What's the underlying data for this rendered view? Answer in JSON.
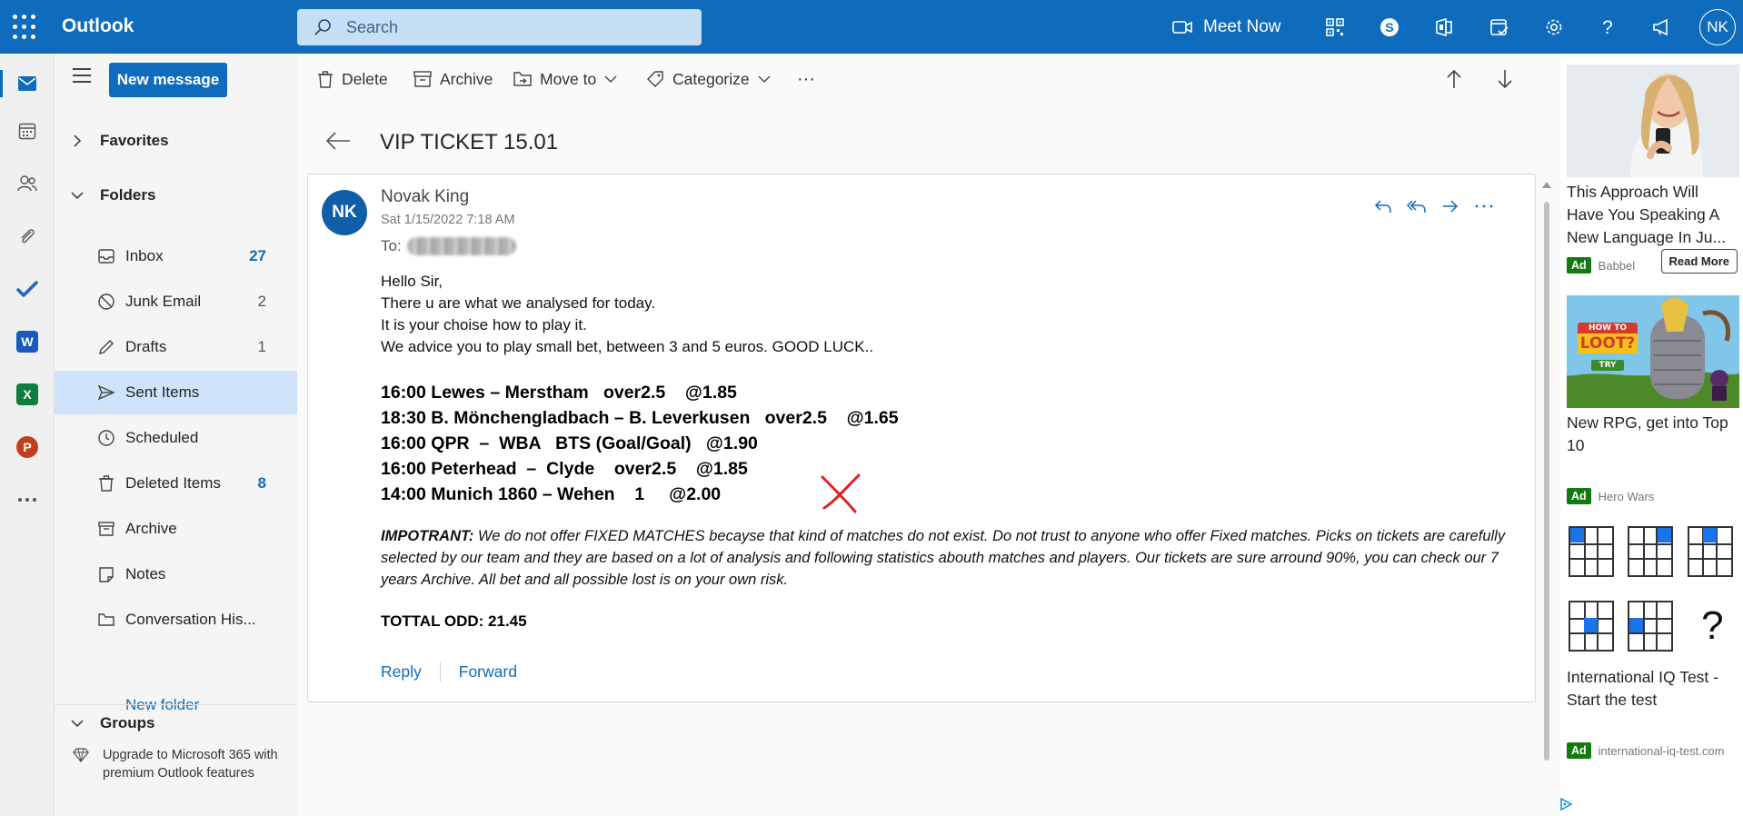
{
  "app": {
    "name": "Outlook",
    "avatar_initials": "NK"
  },
  "search": {
    "placeholder": "Search"
  },
  "topbar": {
    "meet_now": "Meet Now"
  },
  "folder_pane": {
    "new_message": "New message",
    "favorites": "Favorites",
    "folders": "Folders",
    "items": [
      {
        "label": "Inbox",
        "count": "27",
        "unread": true
      },
      {
        "label": "Junk Email",
        "count": "2",
        "unread": false
      },
      {
        "label": "Drafts",
        "count": "1",
        "unread": false
      },
      {
        "label": "Sent Items",
        "count": "",
        "unread": false,
        "selected": true
      },
      {
        "label": "Scheduled",
        "count": "",
        "unread": false
      },
      {
        "label": "Deleted Items",
        "count": "8",
        "unread": true
      },
      {
        "label": "Archive",
        "count": "",
        "unread": false
      },
      {
        "label": "Notes",
        "count": "",
        "unread": false
      },
      {
        "label": "Conversation His...",
        "count": "",
        "unread": false
      }
    ],
    "new_folder": "New folder",
    "groups": "Groups",
    "upgrade": "Upgrade to Microsoft 365 with premium Outlook features"
  },
  "commands": {
    "delete": "Delete",
    "archive": "Archive",
    "move_to": "Move to",
    "categorize": "Categorize",
    "more": "···"
  },
  "message": {
    "subject": "VIP TICKET 15.01",
    "sender_initials": "NK",
    "sender_name": "Novak King",
    "date": "Sat 1/15/2022 7:18 AM",
    "to_label": "To:",
    "greeting": [
      "Hello Sir,",
      "There u are what we analysed for today.",
      "It is your choise how to play it.",
      "We advice you to play small bet, between 3 and 5 euros. GOOD LUCK.."
    ],
    "picks": [
      "16:00 Lewes – Merstham   over2.5    @1.85",
      "18:30 B. Mönchengladbach – B. Leverkusen   over2.5    @1.65",
      "16:00 QPR  –  WBA   BTS (Goal/Goal)   @1.90",
      "16:00 Peterhead  –  Clyde    over2.5    @1.85",
      "14:00 Munich 1860 – Wehen    1     @2.00"
    ],
    "important_label": "IMPOTRANT:",
    "important_text": " We do not offer FIXED MATCHES becayse that kind of matches do not exist. Do not trust to anyone who offer Fixed matches. Picks on tickets are carefully selected by our team and they are based on a lot of analysis and following statistics abouth matches and players. Our tickets are sure arround 90%, you can check our 7 years Archive. All bet and all possible lost is on your own risk.",
    "total": "TOTTAL ODD: 21.45",
    "reply": "Reply",
    "forward": "Forward"
  },
  "ads": [
    {
      "title": "This Approach Will Have You Speaking A New Language In Ju...",
      "badge": "Ad",
      "source": "Babbel",
      "button": "Read More"
    },
    {
      "title": "New RPG, get into Top 10",
      "badge": "Ad",
      "source": "Hero Wars",
      "banner_top": "HOW TO",
      "banner_main": "LOOT?",
      "banner_try": "TRY"
    },
    {
      "title": "International IQ Test - Start the test",
      "badge": "Ad",
      "source": "international-iq-test.com",
      "question_mark": "?"
    }
  ],
  "colors": {
    "brand": "#0f6cbd",
    "selected_folder": "#cfe4fa",
    "ad_badge": "#107c10",
    "red_mark": "#e02020"
  }
}
